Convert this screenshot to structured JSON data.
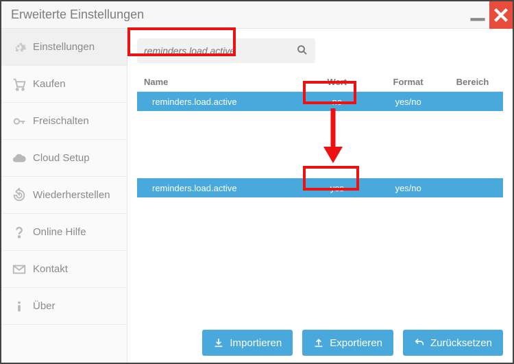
{
  "window": {
    "title": "Erweiterte Einstellungen"
  },
  "sidebar": {
    "items": [
      {
        "label": "Einstellungen",
        "icon": "gear"
      },
      {
        "label": "Kaufen",
        "icon": "cart"
      },
      {
        "label": "Freischalten",
        "icon": "key"
      },
      {
        "label": "Cloud Setup",
        "icon": "cloud"
      },
      {
        "label": "Wiederherstellen",
        "icon": "restore"
      },
      {
        "label": "Online Hilfe",
        "icon": "question"
      },
      {
        "label": "Kontakt",
        "icon": "mail"
      },
      {
        "label": "Über",
        "icon": "info"
      }
    ]
  },
  "search": {
    "placeholder": "reminders.load.active"
  },
  "table": {
    "headers": {
      "name": "Name",
      "wert": "Wert",
      "format": "Format",
      "bereich": "Bereich"
    },
    "rows": [
      {
        "name": "reminders.load.active",
        "wert": "no",
        "format": "yes/no",
        "bereich": ""
      },
      {
        "name": "reminders.load.active",
        "wert": "yes",
        "format": "yes/no",
        "bereich": ""
      }
    ]
  },
  "buttons": {
    "import": "Importieren",
    "export": "Exportieren",
    "reset": "Zurücksetzen"
  }
}
